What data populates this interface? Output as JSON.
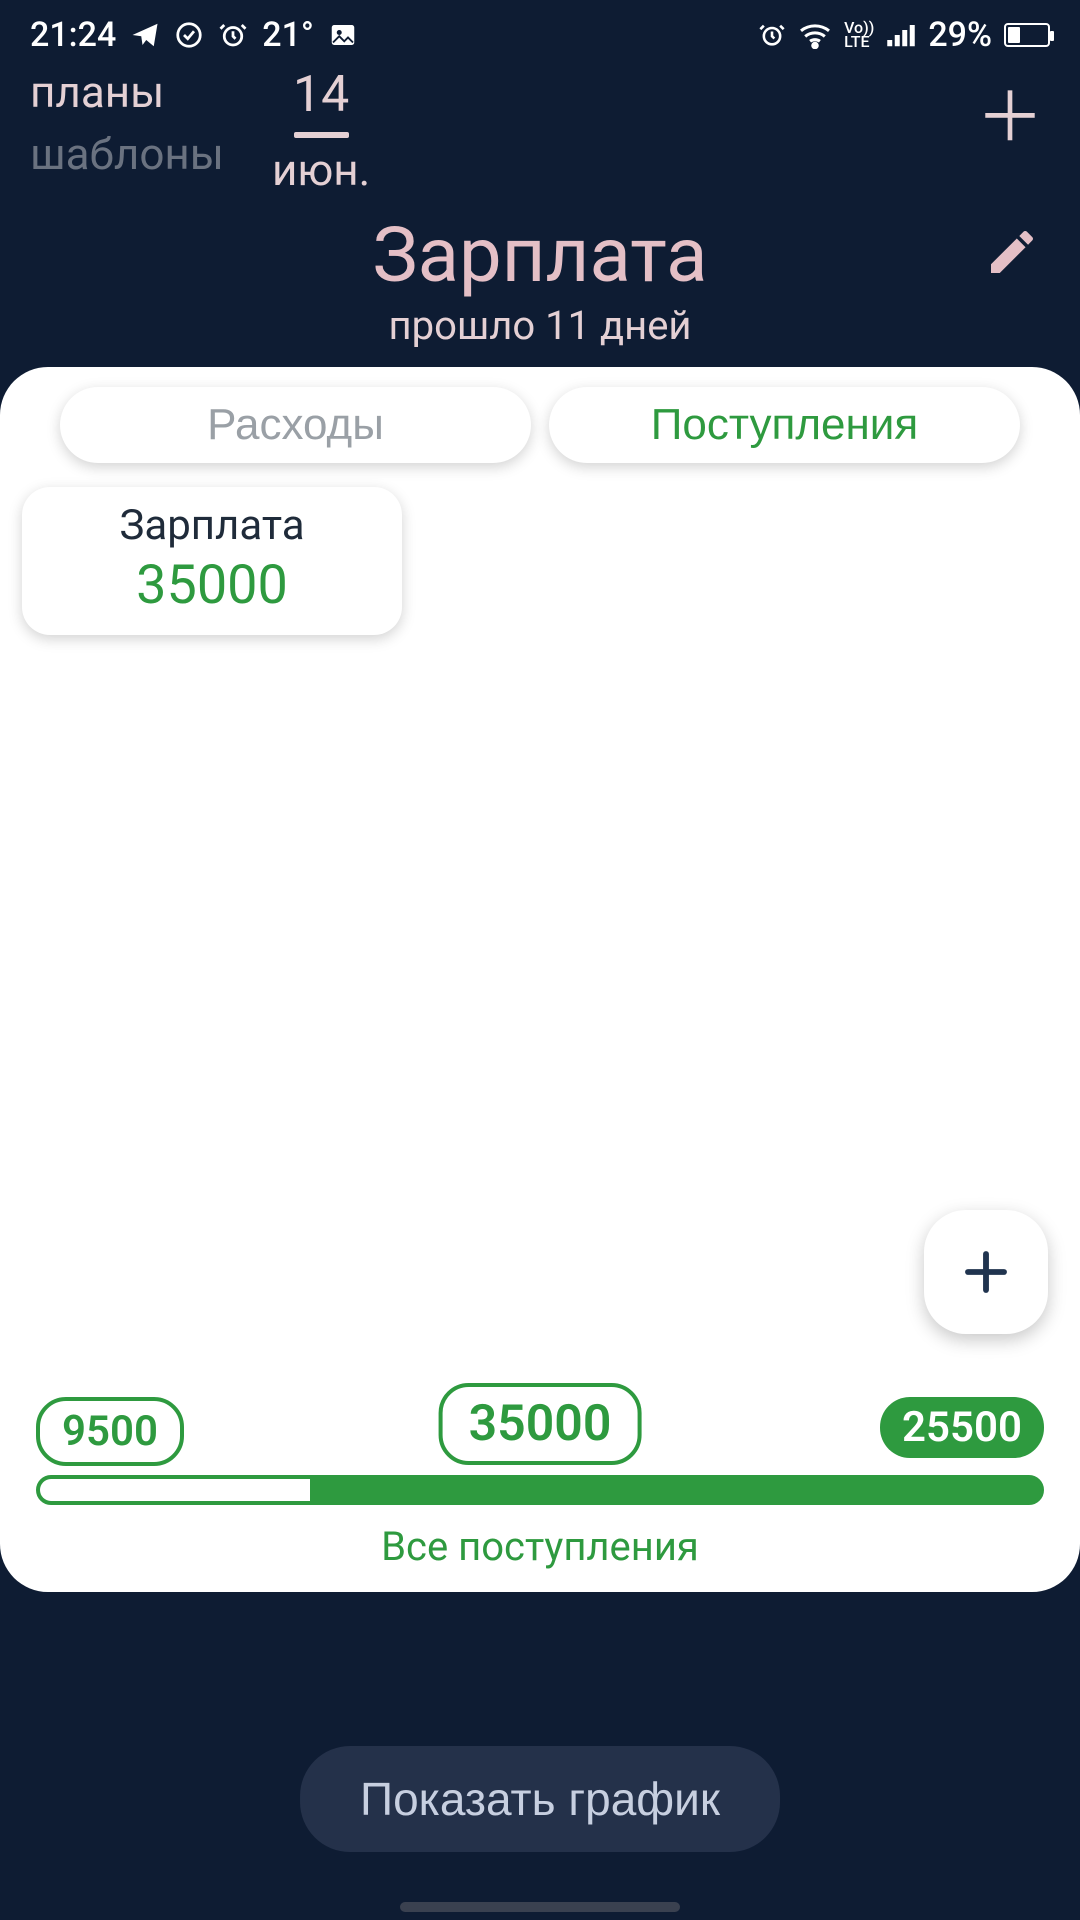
{
  "status_bar": {
    "time": "21:24",
    "temp": "21°",
    "volte": "Vo))\nLTE",
    "battery_pct": "29%",
    "battery_level_pct": 29
  },
  "header": {
    "nav_plans": "планы",
    "nav_templates": "шаблоны",
    "date_day": "14",
    "date_month": "июн."
  },
  "title": {
    "name": "Зарплата",
    "subtitle": "прошло 11 дней"
  },
  "tabs": {
    "expenses": "Расходы",
    "income": "Поступления"
  },
  "items": [
    {
      "name": "Зарплата",
      "amount": "35000"
    }
  ],
  "summary": {
    "left": "9500",
    "center": "35000",
    "right": "25500",
    "empty_pct": 27,
    "all_label": "Все поступления"
  },
  "show_graph": "Показать график",
  "colors": {
    "green": "#2e9a3f",
    "pink": "#e4bfc6",
    "bg_dark": "#0e1c33"
  }
}
